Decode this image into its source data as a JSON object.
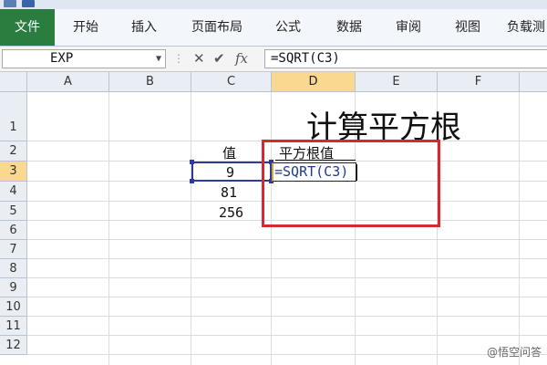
{
  "ribbon": {
    "tabs": [
      "文件",
      "开始",
      "插入",
      "页面布局",
      "公式",
      "数据",
      "审阅",
      "视图",
      "负载测"
    ]
  },
  "formula_bar": {
    "name_box": "EXP",
    "cancel_symbol": "✕",
    "enter_symbol": "✔",
    "fx_symbol": "fx",
    "formula": "=SQRT(C3)"
  },
  "sheet": {
    "columns": [
      "A",
      "B",
      "C",
      "D",
      "E",
      "F"
    ],
    "rows": [
      "1",
      "2",
      "3",
      "4",
      "5",
      "6",
      "7",
      "8",
      "9",
      "10",
      "11",
      "12"
    ],
    "title": "计算平方根",
    "header_value": "值",
    "header_sqrt": "平方根值",
    "values": [
      "9",
      "81",
      "256"
    ],
    "editing_cell_text": "=SQRT(C3)",
    "active_column": "D",
    "active_row": "3"
  },
  "watermark": "@悟空问答"
}
